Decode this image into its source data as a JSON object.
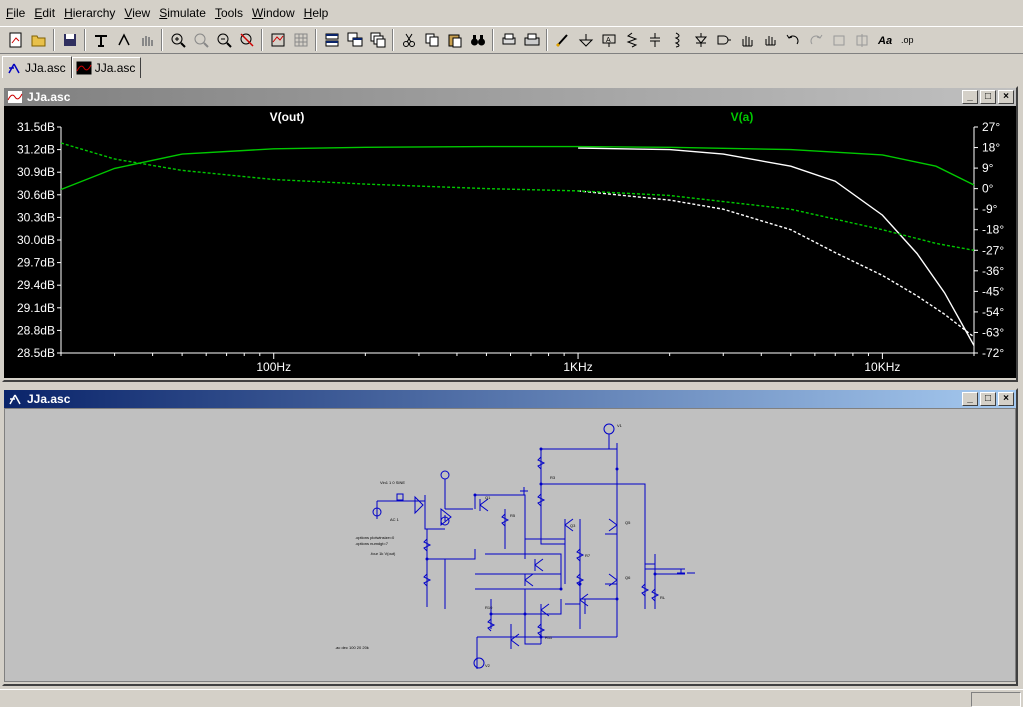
{
  "menu": [
    {
      "id": "file",
      "label": "File"
    },
    {
      "id": "edit",
      "label": "Edit"
    },
    {
      "id": "hierarchy",
      "label": "Hierarchy"
    },
    {
      "id": "view",
      "label": "View"
    },
    {
      "id": "simulate",
      "label": "Simulate"
    },
    {
      "id": "tools",
      "label": "Tools"
    },
    {
      "id": "window",
      "label": "Window"
    },
    {
      "id": "help",
      "label": "Help"
    }
  ],
  "tabs": [
    {
      "label": "JJa.asc",
      "icon": "schematic-icon",
      "active": true
    },
    {
      "label": "JJa.asc",
      "icon": "waveform-icon",
      "active": false
    }
  ],
  "plot_window": {
    "title": "JJa.asc",
    "icon": "waveform-icon"
  },
  "schematic_window": {
    "title": "JJa.asc"
  },
  "chart_data": {
    "type": "line",
    "x_scale": "log",
    "xlim": [
      20,
      20000
    ],
    "x_ticks": [
      {
        "v": 100,
        "label": "100Hz"
      },
      {
        "v": 1000,
        "label": "1KHz"
      },
      {
        "v": 10000,
        "label": "10KHz"
      }
    ],
    "left_axis": {
      "unit": "dB",
      "ylim": [
        28.5,
        31.5
      ],
      "ticks": [
        "31.5dB",
        "31.2dB",
        "30.9dB",
        "30.6dB",
        "30.3dB",
        "30.0dB",
        "29.7dB",
        "29.4dB",
        "29.1dB",
        "28.8dB",
        "28.5dB"
      ]
    },
    "right_axis": {
      "unit": "deg",
      "ylim": [
        -72,
        27
      ],
      "ticks": [
        "27°",
        "18°",
        "9°",
        "0°",
        "-9°",
        "-18°",
        "-27°",
        "-36°",
        "-45°",
        "-54°",
        "-63°",
        "-72°"
      ]
    },
    "grid": false,
    "series": [
      {
        "name": "V(out)",
        "color": "#ffffff",
        "kind": "magnitude",
        "x": [
          1000,
          2000,
          3000,
          5000,
          7000,
          10000,
          13000,
          16000,
          20000
        ],
        "y": [
          31.22,
          31.2,
          31.14,
          30.98,
          30.78,
          30.33,
          29.82,
          29.3,
          28.6
        ]
      },
      {
        "name": "V(out)",
        "color": "#ffffff",
        "kind": "phase",
        "x": [
          1000,
          2000,
          3000,
          5000,
          7000,
          10000,
          13000,
          16000,
          20000
        ],
        "y": [
          -1,
          -5,
          -9,
          -18,
          -28,
          -38,
          -47,
          -55,
          -65
        ]
      },
      {
        "name": "V(a)",
        "color": "#00c800",
        "kind": "magnitude",
        "x": [
          20,
          30,
          50,
          100,
          200,
          500,
          1000,
          2000,
          5000,
          10000,
          15000,
          20000
        ],
        "y": [
          30.67,
          30.95,
          31.14,
          31.21,
          31.23,
          31.24,
          31.24,
          31.23,
          31.2,
          31.13,
          30.98,
          30.73
        ]
      },
      {
        "name": "V(a)",
        "color": "#00c800",
        "kind": "phase",
        "x": [
          20,
          30,
          50,
          100,
          200,
          500,
          1000,
          2000,
          5000,
          10000,
          15000,
          20000
        ],
        "y": [
          20,
          13,
          8,
          4,
          2,
          0,
          -1,
          -3,
          -9,
          -18,
          -24,
          -27
        ]
      }
    ]
  },
  "schematic_labels": {
    "directive": ".tran 0 100m 0 100m",
    "params": ".param R1=100k",
    "ac": ".ac dec 100 20 20k",
    "meas": ".four 1k V(out)"
  }
}
